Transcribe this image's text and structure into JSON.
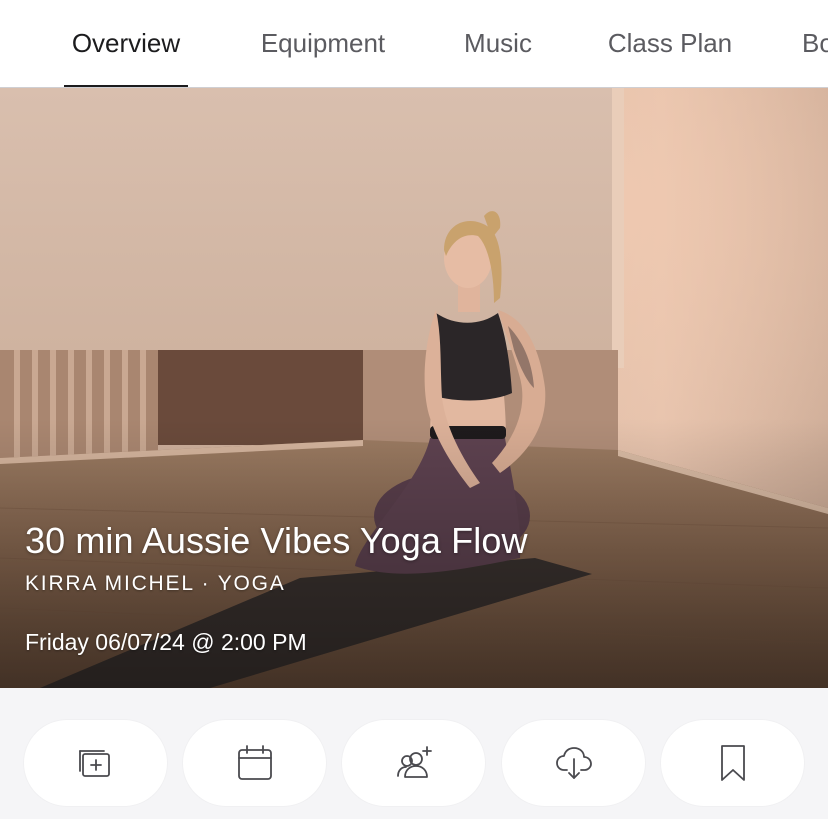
{
  "tabs": [
    {
      "label": "Overview",
      "active": true
    },
    {
      "label": "Equipment",
      "active": false
    },
    {
      "label": "Music",
      "active": false
    },
    {
      "label": "Class Plan",
      "active": false
    },
    {
      "label": "Bo",
      "active": false
    }
  ],
  "hero": {
    "title": "30 min Aussie Vibes Yoga Flow",
    "subtitle": "KIRRA MICHEL · YOGA",
    "schedule": "Friday 06/07/24 @ 2:00 PM"
  },
  "actions": [
    {
      "icon": "add-to-stack-icon"
    },
    {
      "icon": "calendar-icon"
    },
    {
      "icon": "invite-user-icon"
    },
    {
      "icon": "download-icon"
    },
    {
      "icon": "bookmark-icon"
    }
  ],
  "colors": {
    "tab_active": "#1c1c1e",
    "tab_inactive": "#5b5b60",
    "background": "#f5f5f7",
    "button_bg": "#ffffff",
    "icon": "#4a4a4f"
  }
}
